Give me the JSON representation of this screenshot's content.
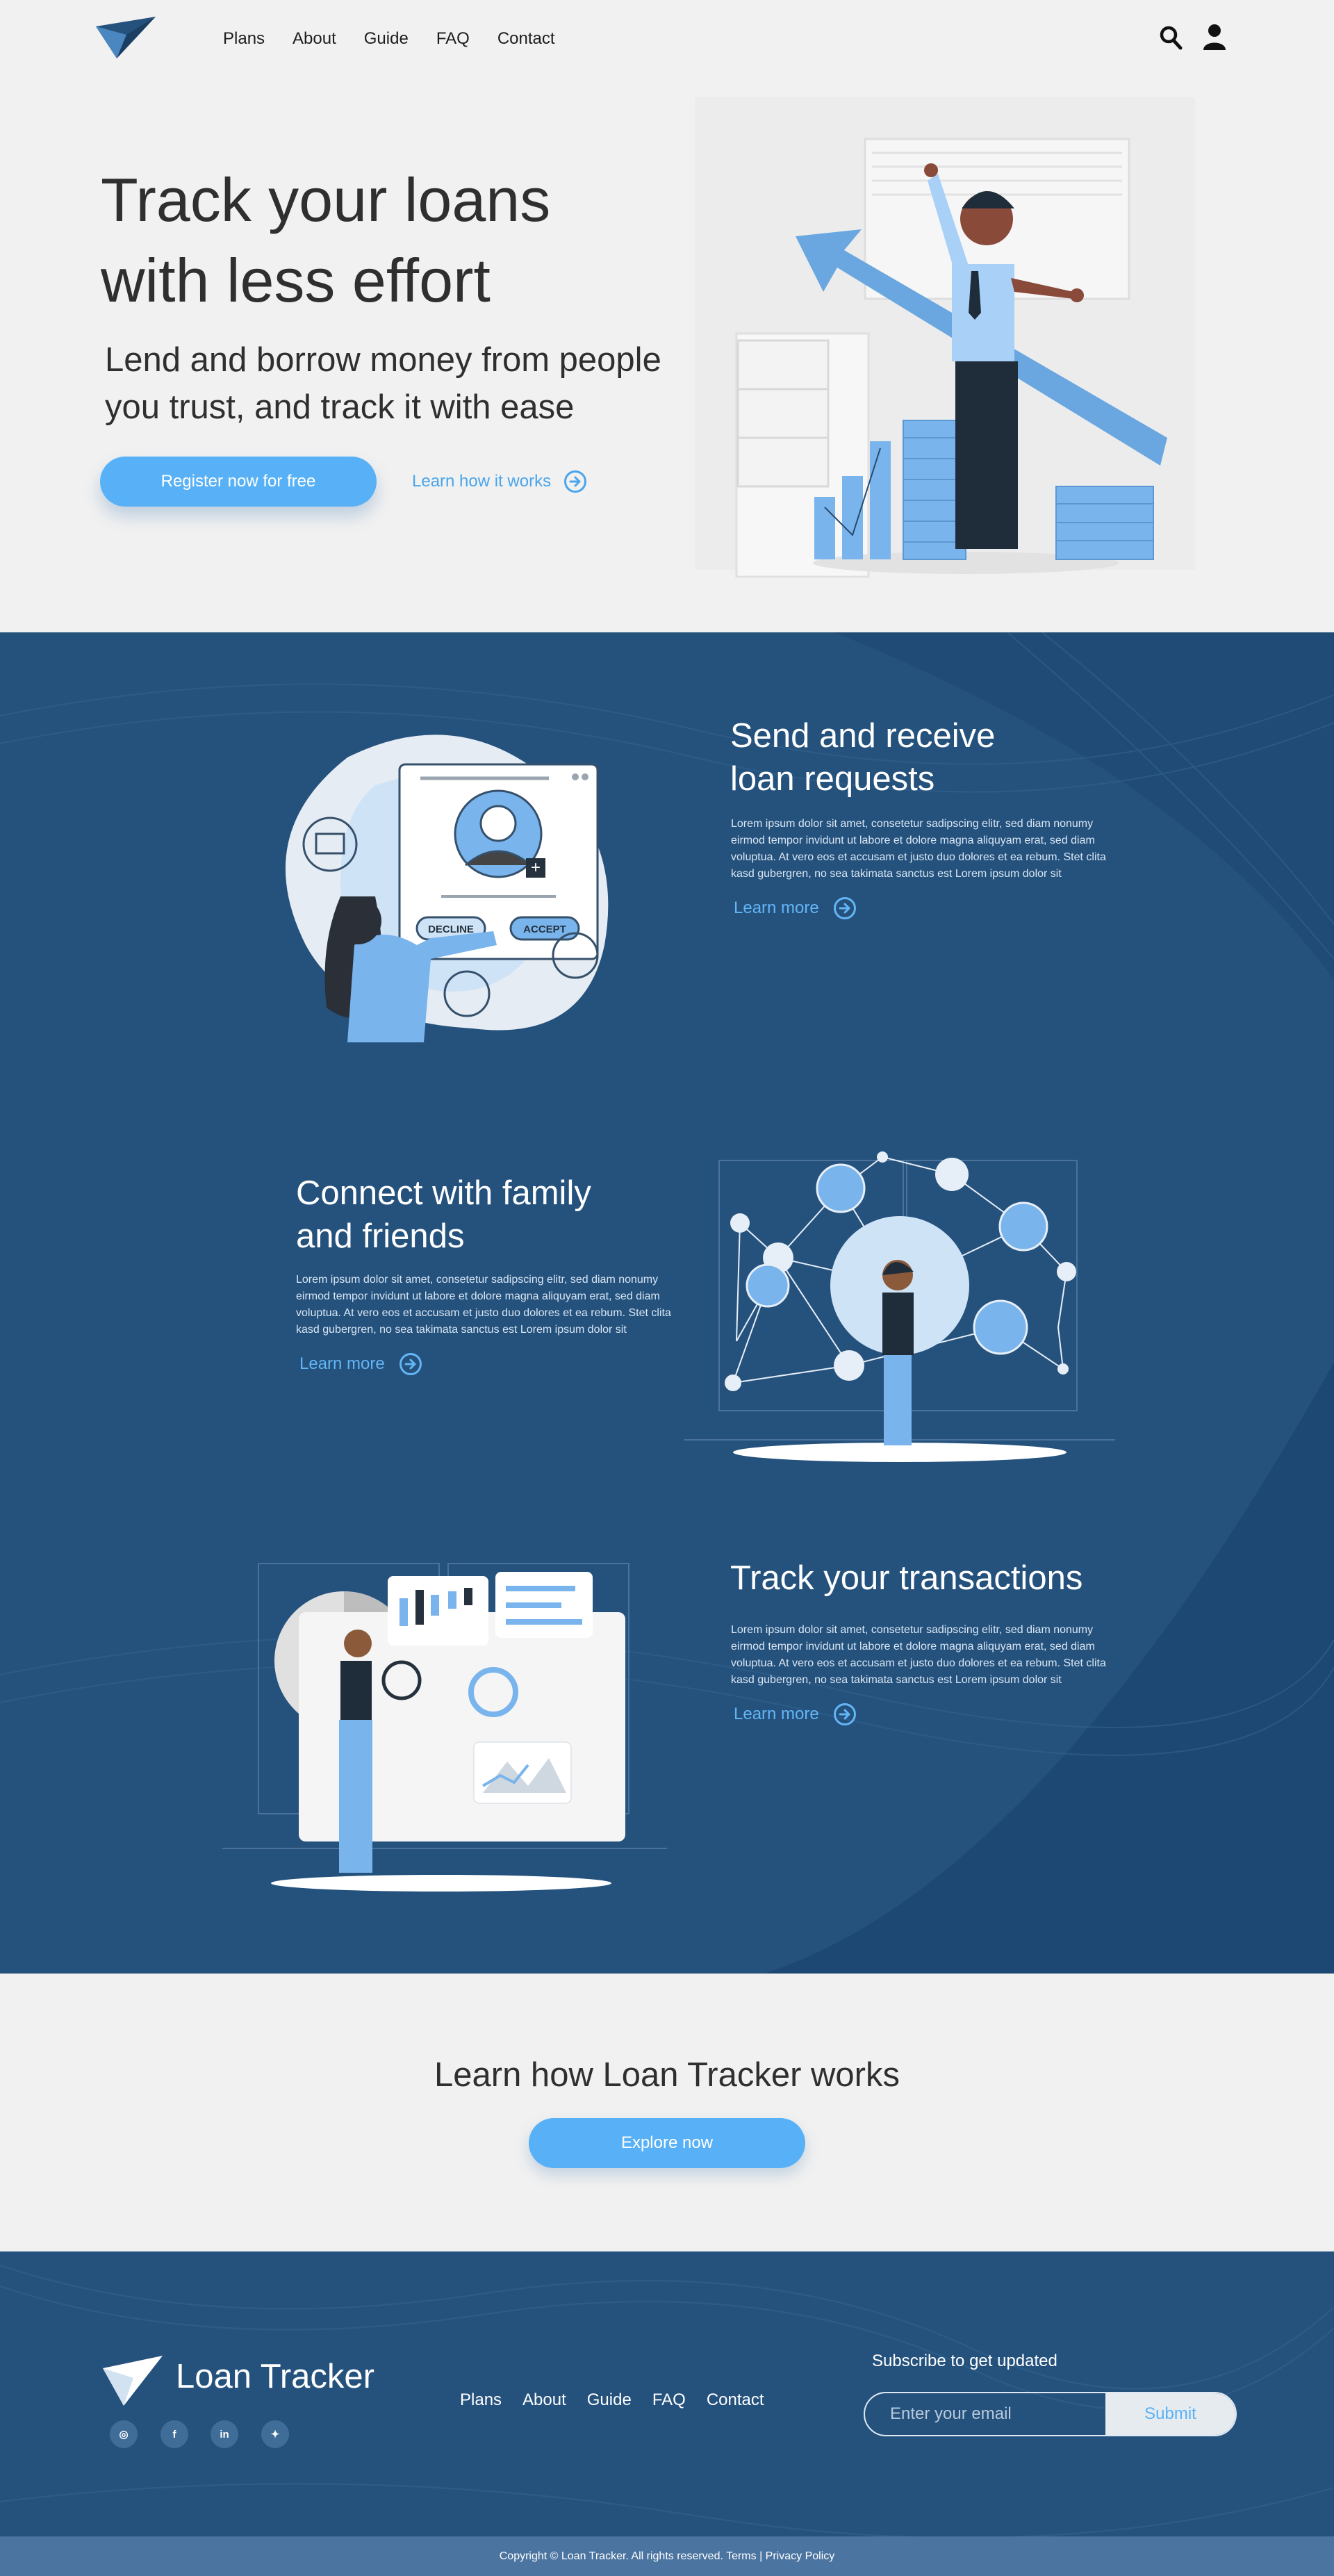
{
  "header": {
    "nav": [
      "Plans",
      "About",
      "Guide",
      "FAQ",
      "Contact"
    ]
  },
  "hero": {
    "title_line1": "Track your loans",
    "title_line2": "with less effort",
    "subtitle_line1": "Lend and borrow money from people",
    "subtitle_line2": "you trust, and track it with ease",
    "register_label": "Register now for free",
    "learn_label": "Learn how it works"
  },
  "features": [
    {
      "title_line1": "Send and receive",
      "title_line2": "loan requests",
      "body": "Lorem ipsum dolor sit amet, consetetur sadipscing elitr, sed diam nonumy eirmod tempor invidunt ut labore et dolore magna aliquyam erat, sed diam voluptua. At vero eos et accusam et justo duo dolores et ea rebum. Stet clita kasd gubergren, no sea takimata sanctus est Lorem ipsum dolor sit",
      "link": "Learn more",
      "art_labels": {
        "decline": "DECLINE",
        "accept": "ACCEPT"
      }
    },
    {
      "title_line1": "Connect with family",
      "title_line2": "and friends",
      "body": "Lorem ipsum dolor sit amet, consetetur sadipscing elitr, sed diam nonumy eirmod tempor invidunt ut labore et dolore magna aliquyam erat, sed diam voluptua. At vero eos et accusam et justo duo dolores et ea rebum. Stet clita kasd gubergren, no sea takimata sanctus est Lorem ipsum dolor sit",
      "link": "Learn more"
    },
    {
      "title_line1": "Track your transactions",
      "title_line2": "",
      "body": "Lorem ipsum dolor sit amet, consetetur sadipscing elitr, sed diam nonumy eirmod tempor invidunt ut labore et dolore magna aliquyam erat, sed diam voluptua. At vero eos et accusam et justo duo dolores et ea rebum. Stet clita kasd gubergren, no sea takimata sanctus est Lorem ipsum dolor sit",
      "link": "Learn more"
    }
  ],
  "learn": {
    "title": "Learn how Loan Tracker works",
    "button": "Explore now"
  },
  "footer": {
    "brand": "Loan Tracker",
    "social": [
      {
        "icon": "instagram-icon",
        "glyph": "◎"
      },
      {
        "icon": "facebook-icon",
        "glyph": "f"
      },
      {
        "icon": "linkedin-icon",
        "glyph": "in"
      },
      {
        "icon": "twitter-icon",
        "glyph": "✦"
      }
    ],
    "nav": [
      "Plans",
      "About",
      "Guide",
      "FAQ",
      "Contact"
    ],
    "subscribe_label": "Subscribe to get updated",
    "email_placeholder": "Enter your email",
    "submit_label": "Submit",
    "copyright": "Copyright © Loan Tracker. All rights reserved. Terms | Privacy Policy"
  },
  "colors": {
    "accent": "#58b1f6",
    "navy": "#25527d",
    "background": "#f1f1f1"
  }
}
